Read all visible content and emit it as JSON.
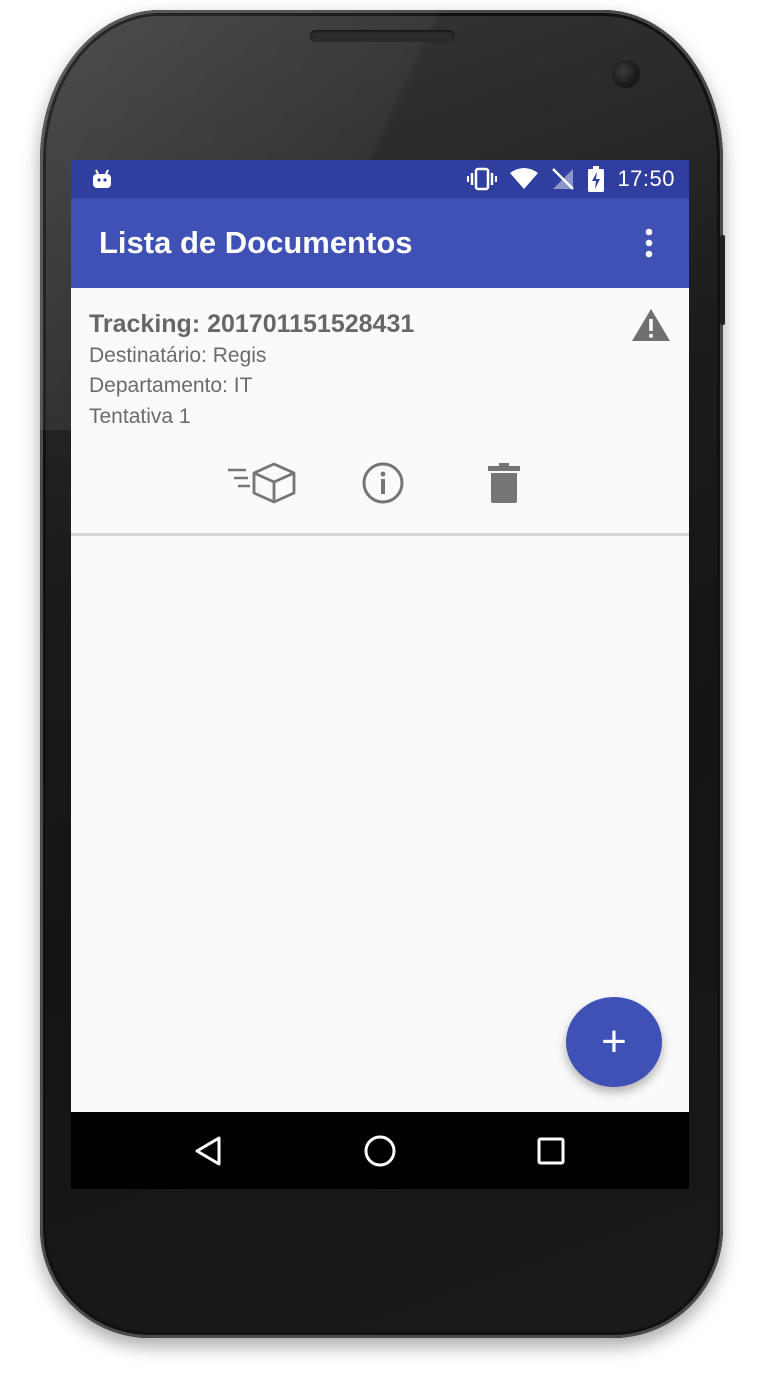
{
  "status_bar": {
    "time": "17:50",
    "icons": [
      "android-debug-icon",
      "vibrate-icon",
      "wifi-icon",
      "no-sim-icon",
      "battery-charging-icon"
    ]
  },
  "app_bar": {
    "title": "Lista de Documentos",
    "menu_icon": "overflow-menu-icon"
  },
  "documents": [
    {
      "tracking": "Tracking: 201701151528431",
      "destinatario": "Destinatário: Regis",
      "departamento": "Departamento: IT",
      "tentativa": "Tentativa 1",
      "status_icon": "warning-icon",
      "actions": [
        "shipping-box-icon",
        "info-icon",
        "delete-icon"
      ]
    }
  ],
  "fab": {
    "label": "+",
    "icon": "add-icon"
  },
  "nav_bar": {
    "icons": [
      "back-icon",
      "home-icon",
      "recents-icon"
    ]
  },
  "colors": {
    "primary": "#3f51b5",
    "primary_dark": "#303f9f",
    "text_secondary": "#6b6b6b",
    "icon_gray": "#757575"
  }
}
